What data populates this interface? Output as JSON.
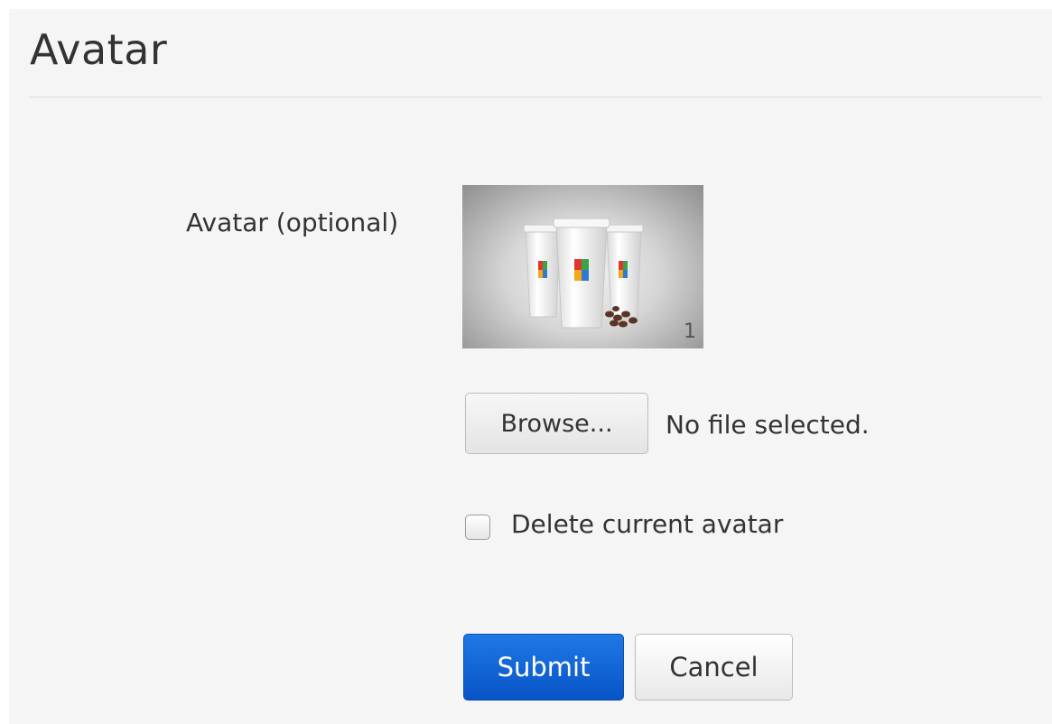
{
  "page": {
    "title": "Avatar"
  },
  "form": {
    "avatar_label": "Avatar (optional)",
    "preview_badge": "1",
    "browse_label": "Browse...",
    "file_status": "No file selected.",
    "delete_label": "Delete current avatar",
    "delete_checked": false,
    "submit_label": "Submit",
    "cancel_label": "Cancel"
  },
  "colors": {
    "panel_background": "#f5f5f5",
    "primary_button": "#0b5fd6",
    "text": "#333333"
  },
  "icons": {
    "avatar_preview": "cups-photo"
  }
}
